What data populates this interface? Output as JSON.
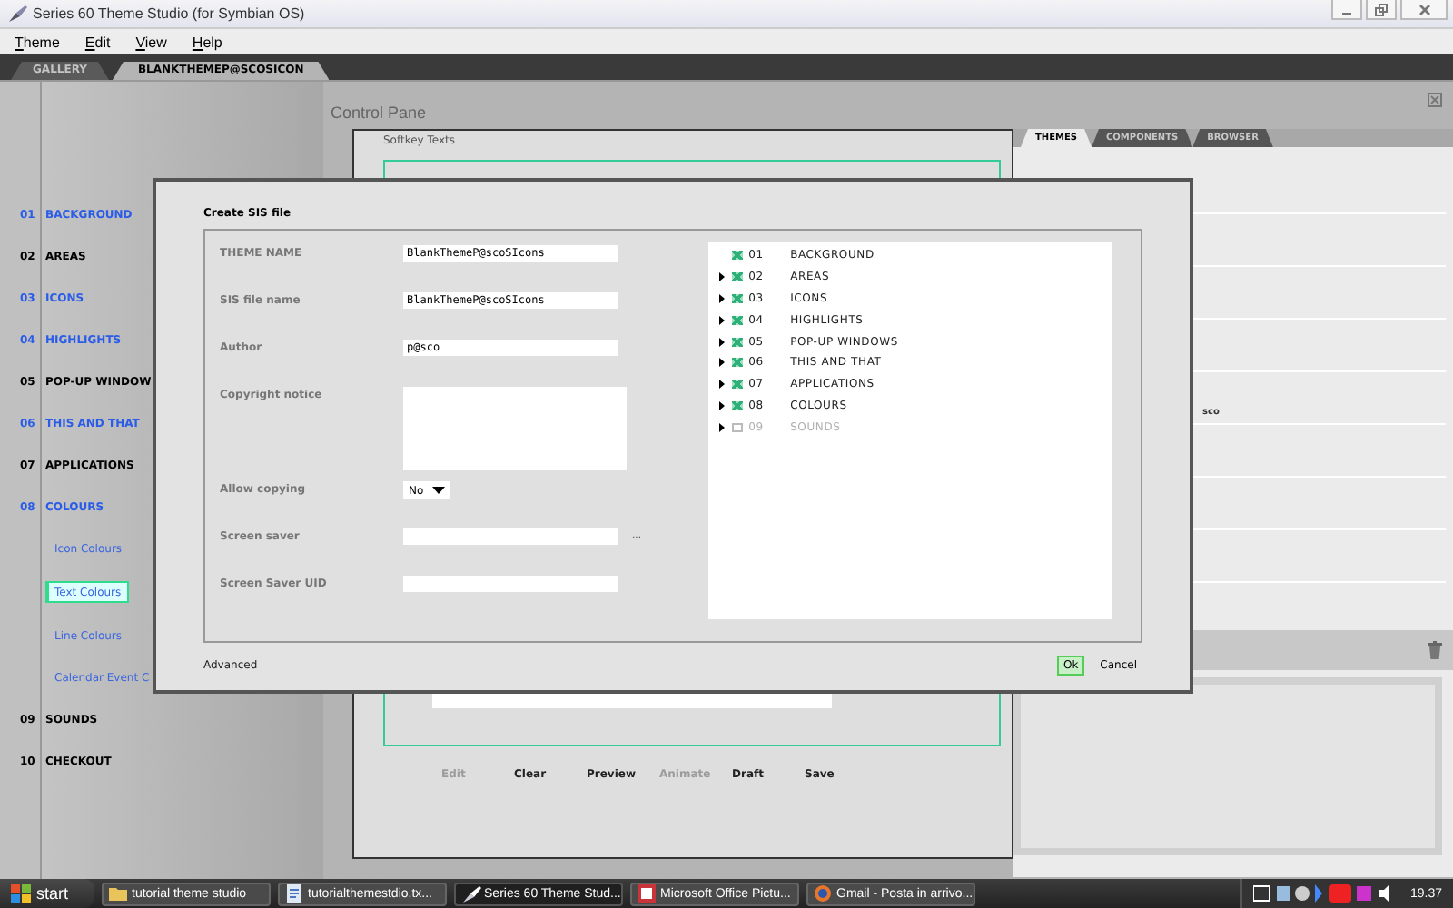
{
  "window": {
    "title": "Series 60 Theme Studio (for Symbian OS)"
  },
  "menu": [
    {
      "label": "Theme"
    },
    {
      "label": "Edit"
    },
    {
      "label": "View"
    },
    {
      "label": "Help"
    }
  ],
  "doc_tabs": [
    {
      "label": "GALLERY",
      "selected": false
    },
    {
      "label": "BLANKTHEMEP@SCOSICON",
      "selected": true
    }
  ],
  "nav": [
    {
      "number": "01",
      "label": "BACKGROUND",
      "highlighted": true
    },
    {
      "number": "02",
      "label": "AREAS",
      "highlighted": false
    },
    {
      "number": "03",
      "label": "ICONS",
      "highlighted": true
    },
    {
      "number": "04",
      "label": "HIGHLIGHTS",
      "highlighted": true
    },
    {
      "number": "05",
      "label": "POP-UP WINDOW",
      "highlighted": false
    },
    {
      "number": "06",
      "label": "THIS AND THAT",
      "highlighted": true
    },
    {
      "number": "07",
      "label": "APPLICATIONS",
      "highlighted": false
    },
    {
      "number": "08",
      "label": "COLOURS",
      "highlighted": true,
      "children": [
        {
          "label": "Icon Colours",
          "selected": false
        },
        {
          "label": "Text Colours",
          "selected": true
        },
        {
          "label": "Line Colours",
          "selected": false
        },
        {
          "label": "Calendar Event C",
          "selected": false
        }
      ]
    },
    {
      "number": "09",
      "label": "SOUNDS",
      "highlighted": false
    },
    {
      "number": "10",
      "label": "CHECKOUT",
      "highlighted": false
    }
  ],
  "control_pane": {
    "title": "Control Pane",
    "panel_title": "Softkey Texts",
    "buttons": [
      {
        "label": "Edit",
        "disabled": true
      },
      {
        "label": "Clear",
        "disabled": false
      },
      {
        "label": "Preview",
        "disabled": false
      },
      {
        "label": "Animate",
        "disabled": true
      },
      {
        "label": "Draft",
        "disabled": false
      },
      {
        "label": "Save",
        "disabled": false
      }
    ]
  },
  "side_panel": {
    "tabs": [
      {
        "label": "THEMES",
        "selected": true
      },
      {
        "label": "COMPONENTS",
        "selected": false
      },
      {
        "label": "BROWSER",
        "selected": false
      }
    ],
    "items": [
      "sco"
    ]
  },
  "dialog": {
    "title": "Create SIS file",
    "fields": [
      {
        "label": "THEME NAME",
        "kind": "text",
        "value": "BlankThemeP@scoSIcons"
      },
      {
        "label": "SIS file name",
        "kind": "text",
        "value": "BlankThemeP@scoSIcons"
      },
      {
        "label": "Author",
        "kind": "text",
        "value": "p@sco"
      },
      {
        "label": "Copyright notice",
        "kind": "textarea"
      },
      {
        "label": "Allow copying",
        "kind": "select",
        "value": "No"
      },
      {
        "label": "Screen saver",
        "kind": "file",
        "browse_label": "..."
      },
      {
        "label": "Screen Saver UID",
        "kind": "text"
      }
    ],
    "tree": [
      {
        "number": "01",
        "label": "BACKGROUND",
        "expandable": false,
        "checked": true,
        "disabled": false
      },
      {
        "number": "02",
        "label": "AREAS",
        "expandable": true,
        "checked": true,
        "disabled": false
      },
      {
        "number": "03",
        "label": "ICONS",
        "expandable": true,
        "checked": true,
        "disabled": false
      },
      {
        "number": "04",
        "label": "HIGHLIGHTS",
        "expandable": true,
        "checked": true,
        "disabled": false
      },
      {
        "number": "05",
        "label": "POP-UP WINDOWS",
        "expandable": true,
        "checked": true,
        "disabled": false
      },
      {
        "number": "06",
        "label": "THIS AND THAT",
        "expandable": true,
        "checked": true,
        "disabled": false
      },
      {
        "number": "07",
        "label": "APPLICATIONS",
        "expandable": true,
        "checked": true,
        "disabled": false
      },
      {
        "number": "08",
        "label": "COLOURS",
        "expandable": true,
        "checked": true,
        "disabled": false
      },
      {
        "number": "09",
        "label": "SOUNDS",
        "expandable": true,
        "checked": false,
        "disabled": true
      }
    ],
    "link": "Advanced",
    "buttons": [
      {
        "label": "Ok",
        "focused": true
      },
      {
        "label": "Cancel",
        "focused": false
      }
    ]
  },
  "taskbar": {
    "start": "start",
    "tasks": [
      {
        "label": "tutorial theme studio",
        "kind": "folder",
        "selected": false
      },
      {
        "label": "tutorialthemestdio.tx...",
        "kind": "document",
        "selected": false
      },
      {
        "label": "Series 60 Theme Stud...",
        "kind": "app",
        "selected": true
      },
      {
        "label": "Microsoft Office Pictu...",
        "kind": "picture",
        "selected": false
      },
      {
        "label": "Gmail - Posta in arrivo...",
        "kind": "browser",
        "selected": false
      }
    ],
    "clock": "19.37"
  }
}
